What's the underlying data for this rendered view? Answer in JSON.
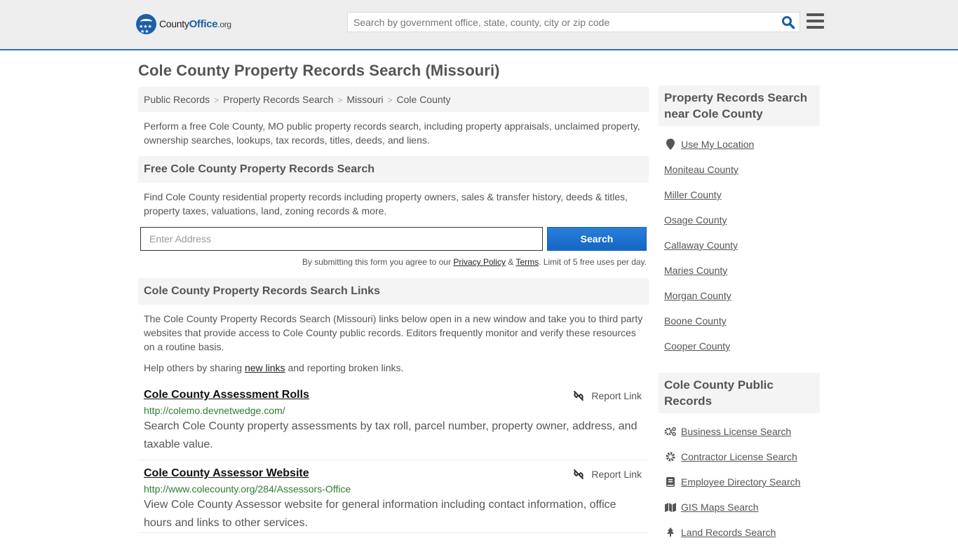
{
  "header": {
    "logo": {
      "county": "County",
      "office": "Office",
      "org": ".org"
    },
    "search_placeholder": "Search by government office, state, county, city or zip code",
    "icons": {
      "search": "search-icon",
      "menu": "hamburger-menu-icon"
    }
  },
  "page_title": "Cole County Property Records Search (Missouri)",
  "breadcrumb": [
    "Public Records",
    "Property Records Search",
    "Missouri",
    "Cole County"
  ],
  "intro": "Perform a free Cole County, MO public property records search, including property appraisals, unclaimed property, ownership searches, lookups, tax records, titles, deeds, and liens.",
  "free_search": {
    "heading": "Free Cole County Property Records Search",
    "text": "Find Cole County residential property records including property owners, sales & transfer history, deeds & titles, property taxes, valuations, land, zoning records & more.",
    "address_placeholder": "Enter Address",
    "button": "Search",
    "disclaimer_pre": "By submitting this form you agree to our ",
    "privacy": "Privacy Policy",
    "amp": " & ",
    "terms": "Terms",
    "disclaimer_post": ". Limit of 5 free uses per day."
  },
  "links_section": {
    "heading": "Cole County Property Records Search Links",
    "text": "The Cole County Property Records Search (Missouri) links below open in a new window and take you to third party websites that provide access to Cole County public records. Editors frequently monitor and verify these resources on a routine basis.",
    "help_pre": "Help others by sharing ",
    "help_link": "new links",
    "help_post": " and reporting broken links.",
    "report_label": "Report Link",
    "items": [
      {
        "title": "Cole County Assessment Rolls",
        "url": "http://colemo.devnetwedge.com/",
        "desc": "Search Cole County property assessments by tax roll, parcel number, property owner, address, and taxable value."
      },
      {
        "title": "Cole County Assessor Website",
        "url": "http://www.colecounty.org/284/Assessors-Office",
        "desc": "View Cole County Assessor website for general information including contact information, office hours and links to other services."
      }
    ]
  },
  "sidebar": {
    "nearby_heading": "Property Records Search near Cole County",
    "use_location": "Use My Location",
    "nearby": [
      "Moniteau County",
      "Miller County",
      "Osage County",
      "Callaway County",
      "Maries County",
      "Morgan County",
      "Boone County",
      "Cooper County"
    ],
    "public_heading": "Cole County Public Records",
    "public_records": [
      {
        "label": "Business License Search",
        "icon": "cogs-icon"
      },
      {
        "label": "Contractor License Search",
        "icon": "gear-icon"
      },
      {
        "label": "Employee Directory Search",
        "icon": "book-icon"
      },
      {
        "label": "GIS Maps Search",
        "icon": "map-icon"
      },
      {
        "label": "Land Records Search",
        "icon": "tree-icon"
      }
    ]
  }
}
